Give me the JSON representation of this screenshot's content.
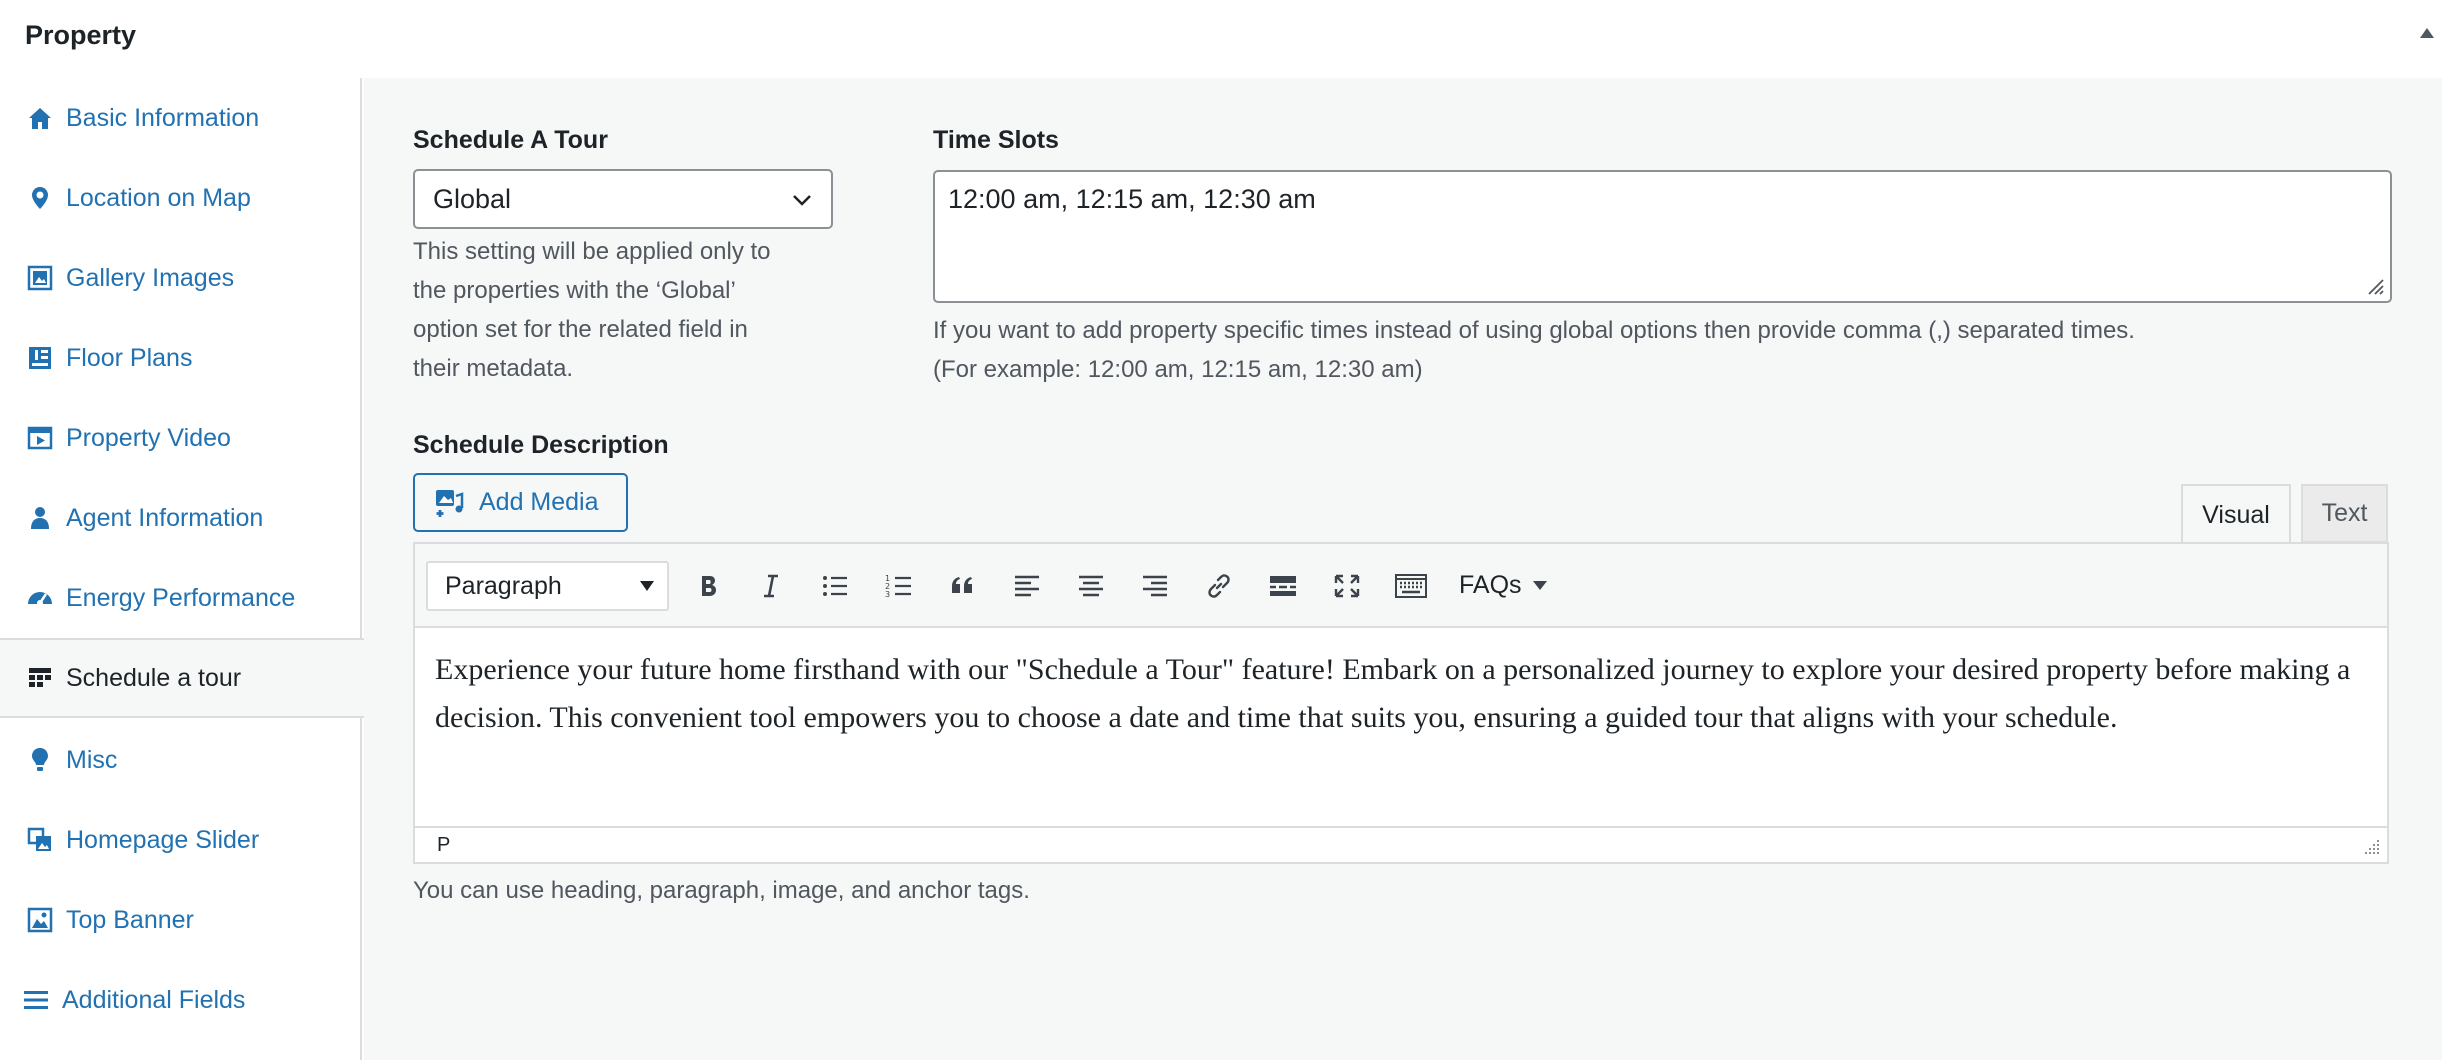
{
  "metabox": {
    "title": "Property"
  },
  "sidebar": {
    "items": [
      {
        "label": "Basic Information",
        "icon": "home-icon"
      },
      {
        "label": "Location on Map",
        "icon": "location-pin-icon"
      },
      {
        "label": "Gallery Images",
        "icon": "gallery-icon"
      },
      {
        "label": "Floor Plans",
        "icon": "floor-plan-icon"
      },
      {
        "label": "Property Video",
        "icon": "video-icon"
      },
      {
        "label": "Agent Information",
        "icon": "person-icon"
      },
      {
        "label": "Energy Performance",
        "icon": "dashboard-icon"
      },
      {
        "label": "Schedule a tour",
        "icon": "calendar-grid-icon",
        "active": true
      },
      {
        "label": "Misc",
        "icon": "lightbulb-icon"
      },
      {
        "label": "Homepage Slider",
        "icon": "slides-icon"
      },
      {
        "label": "Top Banner",
        "icon": "banner-image-icon"
      },
      {
        "label": "Additional Fields",
        "icon": "menu-lines-icon"
      }
    ]
  },
  "schedule": {
    "label": "Schedule A Tour",
    "value": "Global",
    "help_lines": [
      "This setting will be applied only to",
      "the properties with the ‘Global’",
      "option set for the related field in",
      "their metadata."
    ]
  },
  "time_slots": {
    "label": "Time Slots",
    "value": "12:00 am, 12:15 am, 12:30 am",
    "help_lines": [
      "If you want to add property specific times instead of using global options then provide comma (,) separated times.",
      "(For example: 12:00 am, 12:15 am, 12:30 am)"
    ]
  },
  "description": {
    "label": "Schedule Description",
    "add_media_label": "Add Media",
    "tabs": {
      "visual": "Visual",
      "text": "Text"
    },
    "format_value": "Paragraph",
    "faqs_label": "FAQs",
    "body_text": "Experience your future home firsthand with our \"Schedule a Tour\" feature! Embark on a personalized journey to explore your desired property before making a decision. This convenient tool empowers you to choose a date and time that suits you, ensuring a guided tour that aligns with your schedule.",
    "status_path": "P",
    "help": "You can use heading, paragraph, image, and anchor tags."
  },
  "colors": {
    "link": "#2271b1",
    "text": "#1d2327",
    "muted": "#50575e",
    "border": "#dcdcde",
    "panel": "#f6f7f7"
  }
}
